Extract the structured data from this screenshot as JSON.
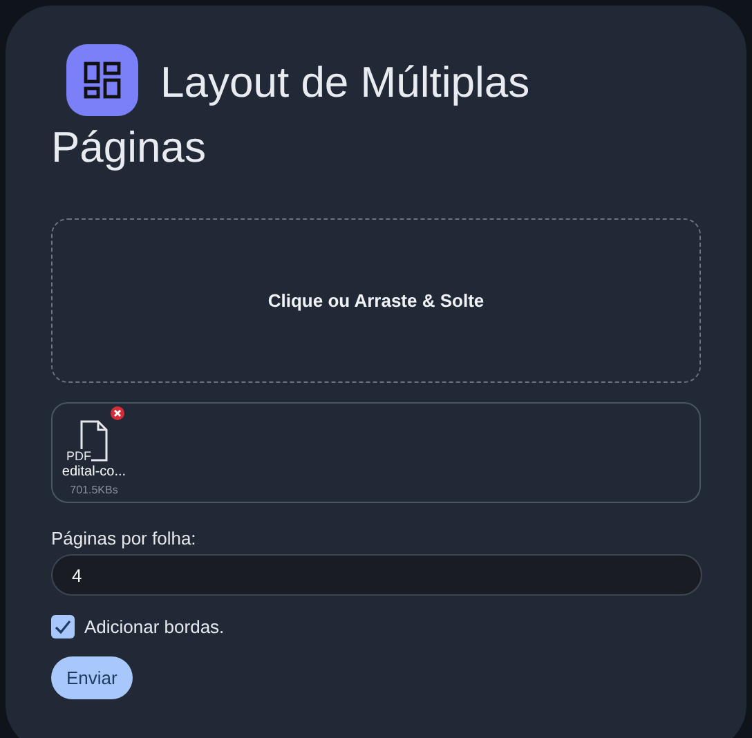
{
  "title_lines": [
    "Layout de Múltiplas",
    "Páginas"
  ],
  "dropzone": {
    "label": "Clique ou Arraste & Solte"
  },
  "files": [
    {
      "type": "PDF",
      "name": "edital-co...",
      "size": "701.5KBs"
    }
  ],
  "pages_per_sheet": {
    "label": "Páginas por folha:",
    "value": "4"
  },
  "borders": {
    "label": "Adicionar bordas.",
    "checked": true
  },
  "submit": {
    "label": "Enviar"
  }
}
